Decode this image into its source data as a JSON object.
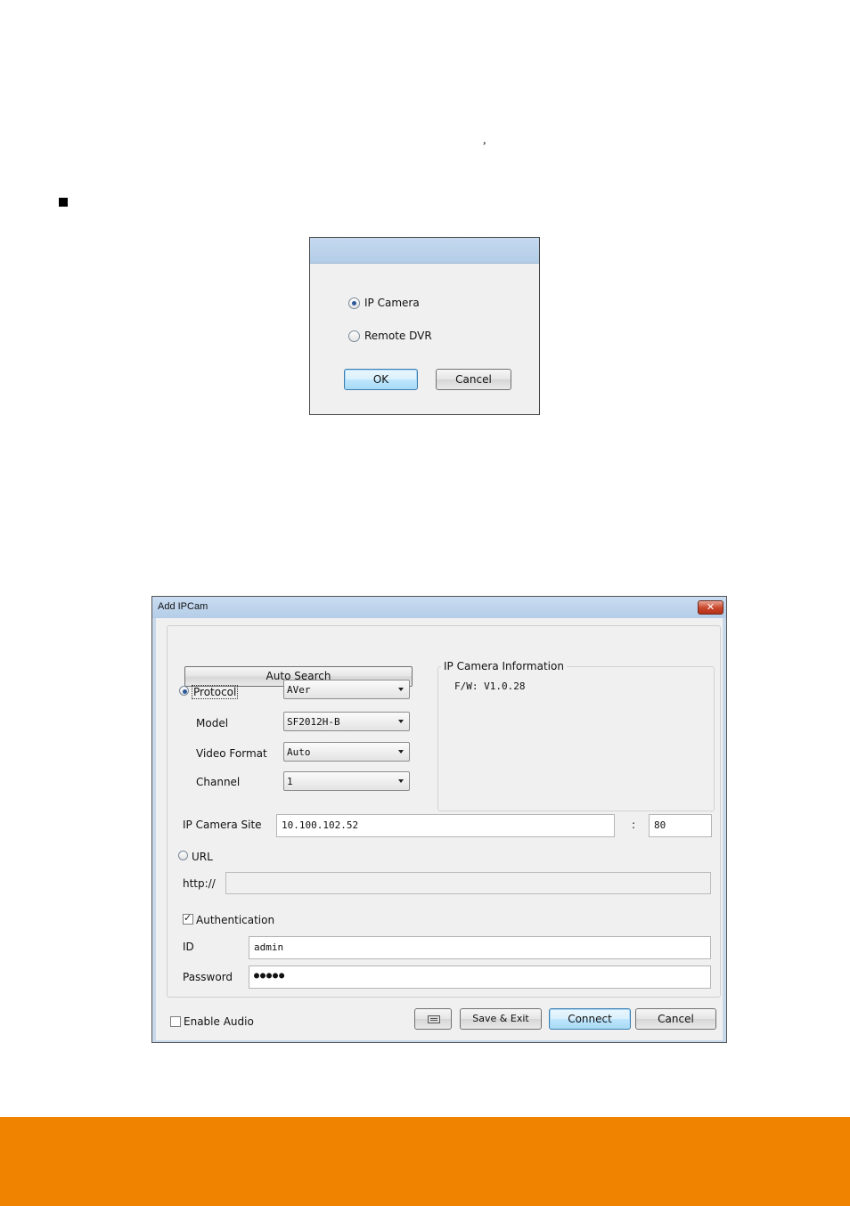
{
  "page": {
    "comma": ",",
    "band_color": "#f08300"
  },
  "select_dialog": {
    "options": [
      {
        "label": "IP Camera",
        "selected": true
      },
      {
        "label": "Remote DVR",
        "selected": false
      }
    ],
    "ok_label": "OK",
    "cancel_label": "Cancel"
  },
  "add_ipcam": {
    "title": "Add IPCam",
    "close_glyph": "✕",
    "auto_search_label": "Auto Search",
    "protocol": {
      "label": "Protocol",
      "value": "AVer",
      "selected": true
    },
    "model": {
      "label": "Model",
      "value": "SF2012H-B"
    },
    "video_format": {
      "label": "Video Format",
      "value": "Auto"
    },
    "channel": {
      "label": "Channel",
      "value": "1"
    },
    "info": {
      "label": "IP Camera Information",
      "firmware": "F/W: V1.0.28"
    },
    "ip_site": {
      "label": "IP Camera Site",
      "value": "10.100.102.52",
      "separator": ":",
      "port": "80"
    },
    "url": {
      "label": "URL",
      "selected": false,
      "prefix": "http://",
      "value": ""
    },
    "authentication": {
      "label": "Authentication",
      "checked": true
    },
    "id": {
      "label": "ID",
      "value": "admin"
    },
    "password": {
      "label": "Password",
      "value": "●●●●●"
    },
    "enable_audio": {
      "label": "Enable Audio",
      "checked": false
    },
    "buttons": {
      "keyboard_icon": "keyboard-icon",
      "save_exit": "Save & Exit",
      "connect": "Connect",
      "cancel": "Cancel"
    }
  }
}
